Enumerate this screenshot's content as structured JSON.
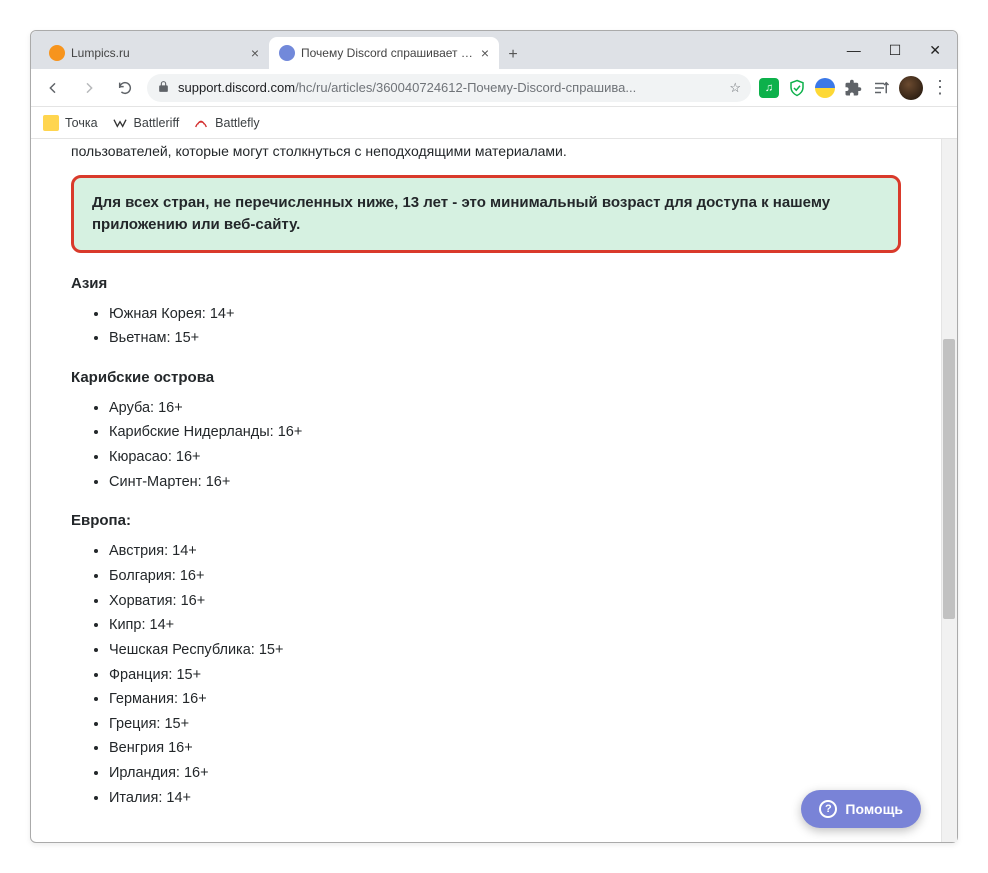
{
  "tabs": [
    {
      "title": "Lumpics.ru",
      "favicon_color": "#f7941d",
      "active": false
    },
    {
      "title": "Почему Discord спрашивает ме",
      "favicon_color": "#7289da",
      "active": true
    }
  ],
  "toolbar": {
    "url_domain": "support.discord.com",
    "url_path": "/hc/ru/articles/360040724612-Почему-Discord-спрашива..."
  },
  "bookmarks": [
    {
      "label": "Точка",
      "icon": "yellow-square"
    },
    {
      "label": "Battleriff",
      "icon": "br"
    },
    {
      "label": "Battlefly",
      "icon": "bf"
    }
  ],
  "content": {
    "intro": "пользователей, которые могут столкнуться с неподходящими материалами.",
    "callout": "Для всех стран, не перечисленных ниже, 13 лет - это минимальный возраст для доступа к нашему приложению или веб-сайту.",
    "regions": [
      {
        "name": "Азия",
        "items": [
          "Южная Корея: 14+",
          "Вьетнам: 15+"
        ]
      },
      {
        "name": "Карибские острова",
        "items": [
          "Аруба: 16+",
          "Карибские Нидерланды: 16+",
          "Кюрасао: 16+",
          "Синт-Мартен: 16+"
        ]
      },
      {
        "name": "Европа:",
        "items": [
          "Австрия: 14+",
          "Болгария: 16+",
          "Хорватия: 16+",
          "Кипр: 14+",
          "Чешская Республика: 15+",
          "Франция: 15+",
          "Германия: 16+",
          "Греция: 15+",
          "Венгрия 16+",
          "Ирландия: 16+",
          "Италия: 14+"
        ]
      }
    ]
  },
  "help_button": "Помощь"
}
